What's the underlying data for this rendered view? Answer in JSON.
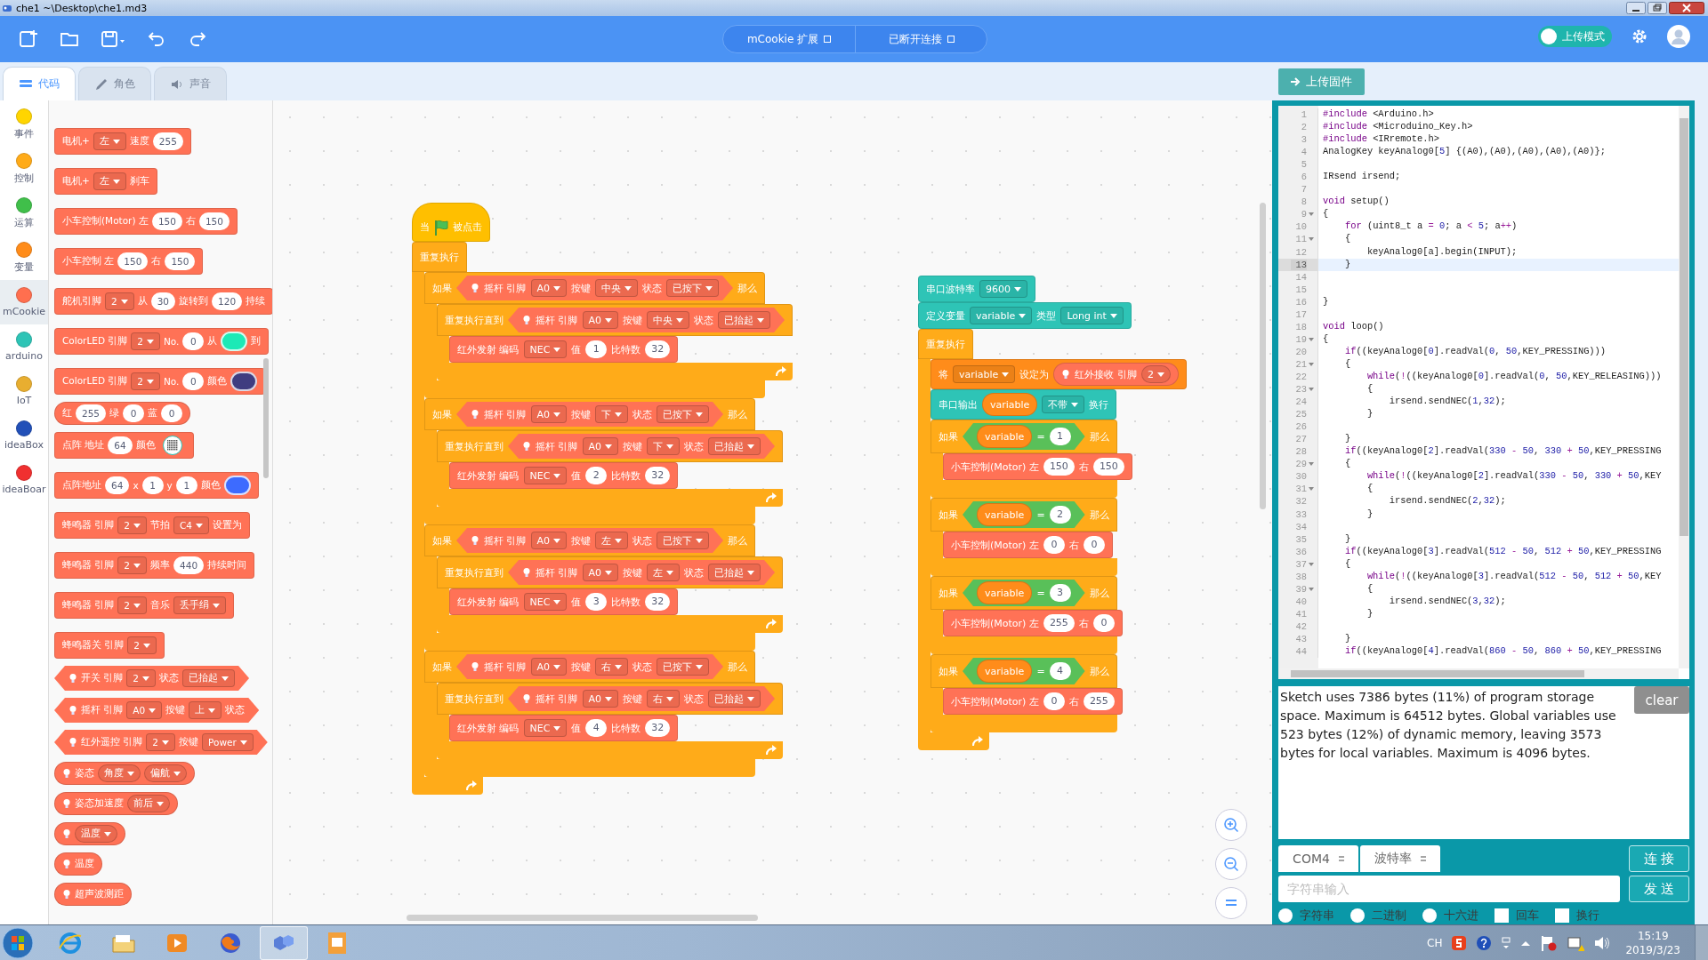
{
  "window": {
    "title": "che1 ~\\Desktop\\che1.md3"
  },
  "toolbar": {
    "extensions": [
      {
        "label": "mCookie 扩展"
      },
      {
        "label": "已断开连接"
      }
    ],
    "mode_toggle": {
      "label": "上传模式",
      "on": true
    }
  },
  "tabs": [
    {
      "kind": "code",
      "label": "代码",
      "selected": true
    },
    {
      "kind": "costume",
      "label": "角色",
      "selected": false
    },
    {
      "kind": "sound",
      "label": "声音",
      "selected": false
    }
  ],
  "upload_button": "上传固件",
  "categories": [
    {
      "label": "事件",
      "color": "#ffd500",
      "selected": false
    },
    {
      "label": "控制",
      "color": "#ffab19",
      "selected": false
    },
    {
      "label": "运算",
      "color": "#40bf4a",
      "selected": false
    },
    {
      "label": "变量",
      "color": "#ff8c1a",
      "selected": false
    },
    {
      "label": "mCookie",
      "color": "#ff6f4f",
      "selected": true
    },
    {
      "label": "arduino",
      "color": "#2ec4b6",
      "selected": false
    },
    {
      "label": "IoT",
      "color": "#e8ae30",
      "selected": false
    },
    {
      "label": "ideaBox",
      "color": "#2250b8",
      "selected": false
    },
    {
      "label": "ideaBoar",
      "color": "#f03030",
      "selected": false
    }
  ],
  "palette": {
    "blocks": [
      {
        "kind": "command",
        "color": "#ff7256",
        "parts": [
          "电机+",
          {
            "kind": "dropdown",
            "text": "左"
          },
          "速度",
          {
            "kind": "number",
            "text": "255"
          }
        ]
      },
      {
        "kind": "command",
        "color": "#ff7256",
        "parts": [
          "电机+",
          {
            "kind": "dropdown",
            "text": "左"
          },
          "刹车"
        ]
      },
      {
        "kind": "command",
        "color": "#ff7256",
        "parts": [
          "小车控制(Motor) 左",
          {
            "kind": "number",
            "text": "150"
          },
          "右",
          {
            "kind": "number",
            "text": "150"
          }
        ]
      },
      {
        "kind": "command",
        "color": "#ff7256",
        "parts": [
          "小车控制 左",
          {
            "kind": "number",
            "text": "150"
          },
          "右",
          {
            "kind": "number",
            "text": "150"
          }
        ]
      },
      {
        "kind": "command",
        "color": "#ff7256",
        "parts": [
          "舵机引脚",
          {
            "kind": "dropdown",
            "text": "2"
          },
          "从",
          {
            "kind": "number",
            "text": "30"
          },
          "旋转到",
          {
            "kind": "number",
            "text": "120"
          },
          "持续"
        ]
      },
      {
        "kind": "command",
        "color": "#ff7256",
        "parts": [
          "ColorLED 引脚",
          {
            "kind": "dropdown",
            "text": "2"
          },
          "No.",
          {
            "kind": "number",
            "text": "0"
          },
          "从",
          {
            "kind": "color",
            "color": "#1de9b6"
          },
          "到"
        ]
      },
      {
        "kind": "command",
        "color": "#ff7256",
        "parts": [
          "ColorLED 引脚",
          {
            "kind": "dropdown",
            "text": "2"
          },
          "No.",
          {
            "kind": "number",
            "text": "0"
          },
          "颜色",
          {
            "kind": "color",
            "color": "#3f3d80"
          }
        ]
      },
      {
        "kind": "reporter",
        "color": "#ff7256",
        "parts": [
          "红",
          {
            "kind": "number",
            "text": "255"
          },
          "绿",
          {
            "kind": "number",
            "text": "0"
          },
          "蓝",
          {
            "kind": "number",
            "text": "0"
          }
        ]
      },
      {
        "kind": "command",
        "color": "#ff7256",
        "parts": [
          "点阵 地址",
          {
            "kind": "number",
            "text": "64"
          },
          "颜色",
          {
            "kind": "matrix"
          }
        ]
      },
      {
        "kind": "command",
        "color": "#ff7256",
        "parts": [
          "点阵地址",
          {
            "kind": "number",
            "text": "64"
          },
          "x",
          {
            "kind": "number",
            "text": "1"
          },
          "y",
          {
            "kind": "number",
            "text": "1"
          },
          "颜色",
          {
            "kind": "color",
            "color": "#3d6bff"
          }
        ]
      },
      {
        "kind": "command",
        "color": "#ff7256",
        "parts": [
          "蜂鸣器 引脚",
          {
            "kind": "dropdown",
            "text": "2"
          },
          "节拍",
          {
            "kind": "dropdown",
            "text": "C4"
          },
          "设置为"
        ]
      },
      {
        "kind": "command",
        "color": "#ff7256",
        "parts": [
          "蜂鸣器 引脚",
          {
            "kind": "dropdown",
            "text": "2"
          },
          "频率",
          {
            "kind": "number",
            "text": "440"
          },
          "持续时间"
        ]
      },
      {
        "kind": "command",
        "color": "#ff7256",
        "parts": [
          "蜂鸣器 引脚",
          {
            "kind": "dropdown",
            "text": "2"
          },
          "音乐",
          {
            "kind": "dropdown",
            "text": "丢手绢"
          }
        ]
      },
      {
        "kind": "command",
        "color": "#ff7256",
        "parts": [
          "蜂鸣器关 引脚",
          {
            "kind": "dropdown",
            "text": "2"
          }
        ]
      },
      {
        "kind": "boolean",
        "color": "#ff7256",
        "parts": [
          {
            "kind": "bulb"
          },
          "开关 引脚",
          {
            "kind": "dropdown",
            "text": "2"
          },
          "状态",
          {
            "kind": "dropdown",
            "text": "已抬起"
          }
        ]
      },
      {
        "kind": "boolean",
        "color": "#ff7256",
        "parts": [
          {
            "kind": "bulb"
          },
          "摇杆 引脚",
          {
            "kind": "dropdown",
            "text": "A0"
          },
          "按键",
          {
            "kind": "dropdown",
            "text": "上"
          },
          "状态"
        ]
      },
      {
        "kind": "boolean",
        "color": "#ff7256",
        "parts": [
          {
            "kind": "bulb"
          },
          "红外遥控 引脚",
          {
            "kind": "dropdown",
            "text": "2"
          },
          "按键",
          {
            "kind": "dropdown",
            "text": "Power"
          }
        ]
      },
      {
        "kind": "reporter",
        "color": "#ff7256",
        "parts": [
          {
            "kind": "bulb"
          },
          "姿态",
          {
            "kind": "dropdown",
            "text": "角度"
          },
          {
            "kind": "dropdown",
            "text": "偏航"
          }
        ]
      },
      {
        "kind": "reporter",
        "color": "#ff7256",
        "parts": [
          {
            "kind": "bulb"
          },
          "姿态加速度",
          {
            "kind": "dropdown",
            "text": "前后"
          }
        ]
      },
      {
        "kind": "reporter",
        "color": "#ff7256",
        "parts": [
          {
            "kind": "bulb"
          },
          {
            "kind": "dropdown",
            "text": "温度"
          }
        ]
      },
      {
        "kind": "reporter",
        "color": "#ff7256",
        "parts": [
          {
            "kind": "bulb"
          },
          "温度"
        ]
      },
      {
        "kind": "reporter",
        "color": "#ff7256",
        "parts": [
          {
            "kind": "bulb"
          },
          "超声波测距"
        ]
      }
    ]
  },
  "scripts": [
    {
      "blocks": [
        {
          "kind": "hat",
          "color": "#ffbf00",
          "parts": [
            "当",
            {
              "kind": "flag"
            },
            "被点击"
          ]
        },
        {
          "kind": "cblock",
          "color": "#ffab19",
          "loop": true,
          "parts": [
            "重复执行"
          ],
          "body": [
            {
              "kind": "cblock",
              "color": "#ffab19",
              "loop": false,
              "parts": [
                "如果",
                {
                  "kind": "boolean",
                  "color": "#ff7256",
                  "parts": [
                    {
                      "kind": "bulb"
                    },
                    "摇杆 引脚",
                    {
                      "kind": "dropdown",
                      "text": "A0"
                    },
                    "按键",
                    {
                      "kind": "dropdown",
                      "text": "中央"
                    },
                    "状态",
                    {
                      "kind": "dropdown",
                      "text": "已按下"
                    }
                  ]
                },
                "那么"
              ],
              "body": [
                {
                  "kind": "cblock",
                  "color": "#ffab19",
                  "loop": true,
                  "parts": [
                    "重复执行直到",
                    {
                      "kind": "boolean",
                      "color": "#ff7256",
                      "parts": [
                        {
                          "kind": "bulb"
                        },
                        "摇杆 引脚",
                        {
                          "kind": "dropdown",
                          "text": "A0"
                        },
                        "按键",
                        {
                          "kind": "dropdown",
                          "text": "中央"
                        },
                        "状态",
                        {
                          "kind": "dropdown",
                          "text": "已抬起"
                        }
                      ]
                    }
                  ],
                  "body": [
                    {
                      "kind": "command",
                      "color": "#ff7256",
                      "parts": [
                        "红外发射 编码",
                        {
                          "kind": "dropdown",
                          "text": "NEC"
                        },
                        "值",
                        {
                          "kind": "number",
                          "text": "1"
                        },
                        "比特数",
                        {
                          "kind": "number",
                          "text": "32"
                        }
                      ]
                    }
                  ]
                }
              ]
            },
            {
              "kind": "cblock",
              "color": "#ffab19",
              "loop": false,
              "parts": [
                "如果",
                {
                  "kind": "boolean",
                  "color": "#ff7256",
                  "parts": [
                    {
                      "kind": "bulb"
                    },
                    "摇杆 引脚",
                    {
                      "kind": "dropdown",
                      "text": "A0"
                    },
                    "按键",
                    {
                      "kind": "dropdown",
                      "text": "下"
                    },
                    "状态",
                    {
                      "kind": "dropdown",
                      "text": "已按下"
                    }
                  ]
                },
                "那么"
              ],
              "body": [
                {
                  "kind": "cblock",
                  "color": "#ffab19",
                  "loop": true,
                  "parts": [
                    "重复执行直到",
                    {
                      "kind": "boolean",
                      "color": "#ff7256",
                      "parts": [
                        {
                          "kind": "bulb"
                        },
                        "摇杆 引脚",
                        {
                          "kind": "dropdown",
                          "text": "A0"
                        },
                        "按键",
                        {
                          "kind": "dropdown",
                          "text": "下"
                        },
                        "状态",
                        {
                          "kind": "dropdown",
                          "text": "已抬起"
                        }
                      ]
                    }
                  ],
                  "body": [
                    {
                      "kind": "command",
                      "color": "#ff7256",
                      "parts": [
                        "红外发射 编码",
                        {
                          "kind": "dropdown",
                          "text": "NEC"
                        },
                        "值",
                        {
                          "kind": "number",
                          "text": "2"
                        },
                        "比特数",
                        {
                          "kind": "number",
                          "text": "32"
                        }
                      ]
                    }
                  ]
                }
              ]
            },
            {
              "kind": "cblock",
              "color": "#ffab19",
              "loop": false,
              "parts": [
                "如果",
                {
                  "kind": "boolean",
                  "color": "#ff7256",
                  "parts": [
                    {
                      "kind": "bulb"
                    },
                    "摇杆 引脚",
                    {
                      "kind": "dropdown",
                      "text": "A0"
                    },
                    "按键",
                    {
                      "kind": "dropdown",
                      "text": "左"
                    },
                    "状态",
                    {
                      "kind": "dropdown",
                      "text": "已按下"
                    }
                  ]
                },
                "那么"
              ],
              "body": [
                {
                  "kind": "cblock",
                  "color": "#ffab19",
                  "loop": true,
                  "parts": [
                    "重复执行直到",
                    {
                      "kind": "boolean",
                      "color": "#ff7256",
                      "parts": [
                        {
                          "kind": "bulb"
                        },
                        "摇杆 引脚",
                        {
                          "kind": "dropdown",
                          "text": "A0"
                        },
                        "按键",
                        {
                          "kind": "dropdown",
                          "text": "左"
                        },
                        "状态",
                        {
                          "kind": "dropdown",
                          "text": "已抬起"
                        }
                      ]
                    }
                  ],
                  "body": [
                    {
                      "kind": "command",
                      "color": "#ff7256",
                      "parts": [
                        "红外发射 编码",
                        {
                          "kind": "dropdown",
                          "text": "NEC"
                        },
                        "值",
                        {
                          "kind": "number",
                          "text": "3"
                        },
                        "比特数",
                        {
                          "kind": "number",
                          "text": "32"
                        }
                      ]
                    }
                  ]
                }
              ]
            },
            {
              "kind": "cblock",
              "color": "#ffab19",
              "loop": false,
              "parts": [
                "如果",
                {
                  "kind": "boolean",
                  "color": "#ff7256",
                  "parts": [
                    {
                      "kind": "bulb"
                    },
                    "摇杆 引脚",
                    {
                      "kind": "dropdown",
                      "text": "A0"
                    },
                    "按键",
                    {
                      "kind": "dropdown",
                      "text": "右"
                    },
                    "状态",
                    {
                      "kind": "dropdown",
                      "text": "已按下"
                    }
                  ]
                },
                "那么"
              ],
              "body": [
                {
                  "kind": "cblock",
                  "color": "#ffab19",
                  "loop": true,
                  "parts": [
                    "重复执行直到",
                    {
                      "kind": "boolean",
                      "color": "#ff7256",
                      "parts": [
                        {
                          "kind": "bulb"
                        },
                        "摇杆 引脚",
                        {
                          "kind": "dropdown",
                          "text": "A0"
                        },
                        "按键",
                        {
                          "kind": "dropdown",
                          "text": "右"
                        },
                        "状态",
                        {
                          "kind": "dropdown",
                          "text": "已抬起"
                        }
                      ]
                    }
                  ],
                  "body": [
                    {
                      "kind": "command",
                      "color": "#ff7256",
                      "parts": [
                        "红外发射 编码",
                        {
                          "kind": "dropdown",
                          "text": "NEC"
                        },
                        "值",
                        {
                          "kind": "number",
                          "text": "4"
                        },
                        "比特数",
                        {
                          "kind": "number",
                          "text": "32"
                        }
                      ]
                    }
                  ]
                }
              ]
            }
          ]
        }
      ]
    },
    {
      "blocks": [
        {
          "kind": "command",
          "color": "#2ec4b6",
          "parts": [
            "串口波特率",
            {
              "kind": "dropdown",
              "text": "9600"
            }
          ]
        },
        {
          "kind": "command",
          "color": "#2ec4b6",
          "parts": [
            "定义变量",
            {
              "kind": "dropdown",
              "text": "variable"
            },
            "类型",
            {
              "kind": "dropdown",
              "text": "Long int"
            }
          ]
        },
        {
          "kind": "cblock",
          "color": "#ffab19",
          "loop": true,
          "parts": [
            "重复执行"
          ],
          "body": [
            {
              "kind": "command",
              "color": "#ff8c1a",
              "parts": [
                "将",
                {
                  "kind": "dropdown",
                  "text": "variable"
                },
                "设定为",
                {
                  "kind": "reporter",
                  "color": "#ff7256",
                  "parts": [
                    {
                      "kind": "bulb"
                    },
                    "红外接收 引脚",
                    {
                      "kind": "dropdown",
                      "text": "2"
                    }
                  ]
                }
              ]
            },
            {
              "kind": "command",
              "color": "#2ec4b6",
              "parts": [
                "串口输出",
                {
                  "kind": "reporter",
                  "color": "#ff8c1a",
                  "parts": [
                    "variable"
                  ]
                },
                {
                  "kind": "dropdown",
                  "text": "不带"
                },
                "换行"
              ]
            },
            {
              "kind": "cblock",
              "color": "#ffab19",
              "loop": false,
              "parts": [
                "如果",
                {
                  "kind": "boolean",
                  "color": "#59c059",
                  "parts": [
                    {
                      "kind": "reporter",
                      "color": "#ff8c1a",
                      "parts": [
                        "variable"
                      ]
                    },
                    "=",
                    {
                      "kind": "number",
                      "text": "1"
                    }
                  ]
                },
                "那么"
              ],
              "body": [
                {
                  "kind": "command",
                  "color": "#ff7256",
                  "parts": [
                    "小车控制(Motor) 左",
                    {
                      "kind": "number",
                      "text": "150"
                    },
                    "右",
                    {
                      "kind": "number",
                      "text": "150"
                    }
                  ]
                }
              ]
            },
            {
              "kind": "cblock",
              "color": "#ffab19",
              "loop": false,
              "parts": [
                "如果",
                {
                  "kind": "boolean",
                  "color": "#59c059",
                  "parts": [
                    {
                      "kind": "reporter",
                      "color": "#ff8c1a",
                      "parts": [
                        "variable"
                      ]
                    },
                    "=",
                    {
                      "kind": "number",
                      "text": "2"
                    }
                  ]
                },
                "那么"
              ],
              "body": [
                {
                  "kind": "command",
                  "color": "#ff7256",
                  "parts": [
                    "小车控制(Motor) 左",
                    {
                      "kind": "number",
                      "text": "0"
                    },
                    "右",
                    {
                      "kind": "number",
                      "text": "0"
                    }
                  ]
                }
              ]
            },
            {
              "kind": "cblock",
              "color": "#ffab19",
              "loop": false,
              "parts": [
                "如果",
                {
                  "kind": "boolean",
                  "color": "#59c059",
                  "parts": [
                    {
                      "kind": "reporter",
                      "color": "#ff8c1a",
                      "parts": [
                        "variable"
                      ]
                    },
                    "=",
                    {
                      "kind": "number",
                      "text": "3"
                    }
                  ]
                },
                "那么"
              ],
              "body": [
                {
                  "kind": "command",
                  "color": "#ff7256",
                  "parts": [
                    "小车控制(Motor) 左",
                    {
                      "kind": "number",
                      "text": "255"
                    },
                    "右",
                    {
                      "kind": "number",
                      "text": "0"
                    }
                  ]
                }
              ]
            },
            {
              "kind": "cblock",
              "color": "#ffab19",
              "loop": false,
              "parts": [
                "如果",
                {
                  "kind": "boolean",
                  "color": "#59c059",
                  "parts": [
                    {
                      "kind": "reporter",
                      "color": "#ff8c1a",
                      "parts": [
                        "variable"
                      ]
                    },
                    "=",
                    {
                      "kind": "number",
                      "text": "4"
                    }
                  ]
                },
                "那么"
              ],
              "body": [
                {
                  "kind": "command",
                  "color": "#ff7256",
                  "parts": [
                    "小车控制(Motor) 左",
                    {
                      "kind": "number",
                      "text": "0"
                    },
                    "右",
                    {
                      "kind": "number",
                      "text": "255"
                    }
                  ]
                }
              ]
            }
          ]
        }
      ]
    }
  ],
  "code_editor": {
    "lines": [
      {
        "n": "1",
        "fold": false,
        "current": false,
        "segs": [
          {
            "kind": "keyword",
            "text": "#include"
          },
          " <Arduino.h>"
        ]
      },
      {
        "n": "2",
        "fold": false,
        "current": false,
        "segs": [
          {
            "kind": "keyword",
            "text": "#include"
          },
          " <Microduino_Key.h>"
        ]
      },
      {
        "n": "3",
        "fold": false,
        "current": false,
        "segs": [
          {
            "kind": "keyword",
            "text": "#include"
          },
          " <IRremote.h>"
        ]
      },
      {
        "n": "4",
        "fold": false,
        "current": false,
        "segs": [
          "AnalogKey keyAnalog0[",
          {
            "kind": "number",
            "text": "5"
          },
          "] {(A0),(A0),(A0),(A0),(A0)};"
        ]
      },
      {
        "n": "5",
        "fold": false,
        "current": false
      },
      {
        "n": "6",
        "fold": false,
        "current": false,
        "segs": [
          "IRsend irsend;"
        ]
      },
      {
        "n": "7",
        "fold": false,
        "current": false
      },
      {
        "n": "8",
        "fold": false,
        "current": false,
        "segs": [
          {
            "kind": "keyword",
            "text": "void"
          },
          " setup()"
        ]
      },
      {
        "n": "9",
        "fold": true,
        "current": false,
        "segs": [
          "{"
        ]
      },
      {
        "n": "10",
        "fold": false,
        "current": false,
        "segs": [
          {
            "kind": "keyword",
            "text": "    for"
          },
          " (uint8_t a ",
          {
            "kind": "operator",
            "text": "="
          },
          {
            "kind": "number",
            "text": " 0"
          },
          "; a ",
          {
            "kind": "operator",
            "text": "<"
          },
          {
            "kind": "number",
            "text": " 5"
          },
          "; a",
          {
            "kind": "operator",
            "text": "++"
          },
          ")"
        ]
      },
      {
        "n": "11",
        "fold": true,
        "current": false,
        "segs": [
          "    {"
        ]
      },
      {
        "n": "12",
        "fold": false,
        "current": false,
        "segs": [
          "        keyAnalog0[a].begin(INPUT);"
        ]
      },
      {
        "n": "13",
        "fold": false,
        "current": true,
        "segs": [
          "    }"
        ]
      },
      {
        "n": "14",
        "fold": false,
        "current": false
      },
      {
        "n": "15",
        "fold": false,
        "current": false
      },
      {
        "n": "16",
        "fold": false,
        "current": false,
        "segs": [
          "}"
        ]
      },
      {
        "n": "17",
        "fold": false,
        "current": false
      },
      {
        "n": "18",
        "fold": false,
        "current": false,
        "segs": [
          {
            "kind": "keyword",
            "text": "void"
          },
          " loop()"
        ]
      },
      {
        "n": "19",
        "fold": true,
        "current": false,
        "segs": [
          "{"
        ]
      },
      {
        "n": "20",
        "fold": false,
        "current": false,
        "segs": [
          {
            "kind": "keyword",
            "text": "    if"
          },
          "((keyAnalog0[",
          {
            "kind": "number",
            "text": "0"
          },
          "].readVal(",
          {
            "kind": "number",
            "text": "0"
          },
          ", ",
          {
            "kind": "number",
            "text": "50"
          },
          ",KEY_PRESSING)))"
        ]
      },
      {
        "n": "21",
        "fold": true,
        "current": false,
        "segs": [
          "    {"
        ]
      },
      {
        "n": "22",
        "fold": false,
        "current": false,
        "segs": [
          {
            "kind": "keyword",
            "text": "        while"
          },
          "(",
          {
            "kind": "operator",
            "text": "!"
          },
          "((keyAnalog0[",
          {
            "kind": "number",
            "text": "0"
          },
          "].readVal(",
          {
            "kind": "number",
            "text": "0"
          },
          ", ",
          {
            "kind": "number",
            "text": "50"
          },
          ",KEY_RELEASING)))"
        ]
      },
      {
        "n": "23",
        "fold": true,
        "current": false,
        "segs": [
          "        {"
        ]
      },
      {
        "n": "24",
        "fold": false,
        "current": false,
        "segs": [
          "            irsend.sendNEC(",
          {
            "kind": "number",
            "text": "1"
          },
          ",",
          {
            "kind": "number",
            "text": "32"
          },
          ");"
        ]
      },
      {
        "n": "25",
        "fold": false,
        "current": false,
        "segs": [
          "        }"
        ]
      },
      {
        "n": "26",
        "fold": false,
        "current": false
      },
      {
        "n": "27",
        "fold": false,
        "current": false,
        "segs": [
          "    }"
        ]
      },
      {
        "n": "28",
        "fold": false,
        "current": false,
        "segs": [
          {
            "kind": "keyword",
            "text": "    if"
          },
          "((keyAnalog0[",
          {
            "kind": "number",
            "text": "2"
          },
          "].readVal(",
          {
            "kind": "number",
            "text": "330"
          },
          {
            "kind": "operator",
            "text": " -"
          },
          {
            "kind": "number",
            "text": " 50"
          },
          ", ",
          {
            "kind": "number",
            "text": "330"
          },
          {
            "kind": "operator",
            "text": " +"
          },
          {
            "kind": "number",
            "text": " 50"
          },
          ",KEY_PRESSING"
        ]
      },
      {
        "n": "29",
        "fold": true,
        "current": false,
        "segs": [
          "    {"
        ]
      },
      {
        "n": "30",
        "fold": false,
        "current": false,
        "segs": [
          {
            "kind": "keyword",
            "text": "        while"
          },
          "(",
          {
            "kind": "operator",
            "text": "!"
          },
          "((keyAnalog0[",
          {
            "kind": "number",
            "text": "2"
          },
          "].readVal(",
          {
            "kind": "number",
            "text": "330"
          },
          {
            "kind": "operator",
            "text": " -"
          },
          {
            "kind": "number",
            "text": " 50"
          },
          ", ",
          {
            "kind": "number",
            "text": "330"
          },
          {
            "kind": "operator",
            "text": " +"
          },
          {
            "kind": "number",
            "text": " 50"
          },
          ",KEY"
        ]
      },
      {
        "n": "31",
        "fold": true,
        "current": false,
        "segs": [
          "        {"
        ]
      },
      {
        "n": "32",
        "fold": false,
        "current": false,
        "segs": [
          "            irsend.sendNEC(",
          {
            "kind": "number",
            "text": "2"
          },
          ",",
          {
            "kind": "number",
            "text": "32"
          },
          ");"
        ]
      },
      {
        "n": "33",
        "fold": false,
        "current": false,
        "segs": [
          "        }"
        ]
      },
      {
        "n": "34",
        "fold": false,
        "current": false
      },
      {
        "n": "35",
        "fold": false,
        "current": false,
        "segs": [
          "    }"
        ]
      },
      {
        "n": "36",
        "fold": false,
        "current": false,
        "segs": [
          {
            "kind": "keyword",
            "text": "    if"
          },
          "((keyAnalog0[",
          {
            "kind": "number",
            "text": "3"
          },
          "].readVal(",
          {
            "kind": "number",
            "text": "512"
          },
          {
            "kind": "operator",
            "text": " -"
          },
          {
            "kind": "number",
            "text": " 50"
          },
          ", ",
          {
            "kind": "number",
            "text": "512"
          },
          {
            "kind": "operator",
            "text": " +"
          },
          {
            "kind": "number",
            "text": " 50"
          },
          ",KEY_PRESSING"
        ]
      },
      {
        "n": "37",
        "fold": true,
        "current": false,
        "segs": [
          "    {"
        ]
      },
      {
        "n": "38",
        "fold": false,
        "current": false,
        "segs": [
          {
            "kind": "keyword",
            "text": "        while"
          },
          "(",
          {
            "kind": "operator",
            "text": "!"
          },
          "((keyAnalog0[",
          {
            "kind": "number",
            "text": "3"
          },
          "].readVal(",
          {
            "kind": "number",
            "text": "512"
          },
          {
            "kind": "operator",
            "text": " -"
          },
          {
            "kind": "number",
            "text": " 50"
          },
          ", ",
          {
            "kind": "number",
            "text": "512"
          },
          {
            "kind": "operator",
            "text": " +"
          },
          {
            "kind": "number",
            "text": " 50"
          },
          ",KEY"
        ]
      },
      {
        "n": "39",
        "fold": true,
        "current": false,
        "segs": [
          "        {"
        ]
      },
      {
        "n": "40",
        "fold": false,
        "current": false,
        "segs": [
          "            irsend.sendNEC(",
          {
            "kind": "number",
            "text": "3"
          },
          ",",
          {
            "kind": "number",
            "text": "32"
          },
          ");"
        ]
      },
      {
        "n": "41",
        "fold": false,
        "current": false,
        "segs": [
          "        }"
        ]
      },
      {
        "n": "42",
        "fold": false,
        "current": false
      },
      {
        "n": "43",
        "fold": false,
        "current": false,
        "segs": [
          "    }"
        ]
      },
      {
        "n": "44",
        "fold": false,
        "current": false,
        "segs": [
          {
            "kind": "keyword",
            "text": "    if"
          },
          "((keyAnalog0[",
          {
            "kind": "number",
            "text": "4"
          },
          "].readVal(",
          {
            "kind": "number",
            "text": "860"
          },
          {
            "kind": "operator",
            "text": " -"
          },
          {
            "kind": "number",
            "text": " 50"
          },
          ", ",
          {
            "kind": "number",
            "text": "860"
          },
          {
            "kind": "operator",
            "text": " +"
          },
          {
            "kind": "number",
            "text": " 50"
          },
          ",KEY_PRESSING"
        ]
      }
    ]
  },
  "output": {
    "text": "Sketch uses 7386 bytes (11%) of program storage space. Maximum is 64512 bytes. Global variables use 523 bytes (12%) of dynamic memory, leaving 3573 bytes for local variables. Maximum is 4096 bytes.",
    "clear_button": "clear"
  },
  "serial": {
    "port": "COM4",
    "baud": "波特率",
    "connect_button": "连 接",
    "input_placeholder": "字符串输入",
    "send_button": "发 送",
    "formats": [
      {
        "label": "字符串",
        "selected": false
      },
      {
        "label": "二进制",
        "selected": false
      },
      {
        "label": "十六进",
        "selected": false
      }
    ],
    "options": [
      {
        "label": "回车",
        "checked": false
      },
      {
        "label": "换行",
        "checked": false
      }
    ]
  },
  "taskbar": {
    "apps": [
      {
        "kind": "ie",
        "active": false
      },
      {
        "kind": "folder",
        "active": false
      },
      {
        "kind": "media",
        "active": false
      },
      {
        "kind": "firefox",
        "active": false
      },
      {
        "kind": "blocks",
        "active": true
      },
      {
        "kind": "pdf",
        "active": false
      }
    ],
    "tray": {
      "language": "CH",
      "time": "15:19",
      "date": "2019/3/23"
    }
  }
}
